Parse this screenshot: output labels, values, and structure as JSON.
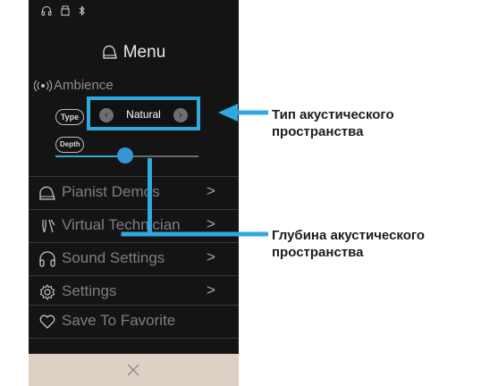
{
  "status_icons": [
    "headphones-icon",
    "usb-icon",
    "bluetooth-icon"
  ],
  "menu": {
    "title": "Menu",
    "icon": "piano-icon"
  },
  "ambience": {
    "label": "Ambience",
    "type_label": "Type",
    "type_value": "Natural",
    "depth_label": "Depth",
    "depth_level": 0.49
  },
  "menu_items": [
    {
      "label": "Pianist Demos",
      "icon": "grand-piano-icon",
      "chevron": ">"
    },
    {
      "label": "Virtual Technician",
      "icon": "tuning-fork-icon",
      "chevron": ">"
    },
    {
      "label": "Sound Settings",
      "icon": "headphones-icon",
      "chevron": ">"
    },
    {
      "label": "Settings",
      "icon": "gear-icon",
      "chevron": ">"
    },
    {
      "label": "Save To Favorite",
      "icon": "heart-icon",
      "chevron": ""
    }
  ],
  "callouts": {
    "type": [
      "Тип акустического",
      "пространства"
    ],
    "depth": [
      "Глубина акустического",
      "пространства"
    ]
  },
  "colors": {
    "accent": "#2fa9df",
    "panel": "#141414",
    "bottom_bar": "#ddd0c5"
  }
}
